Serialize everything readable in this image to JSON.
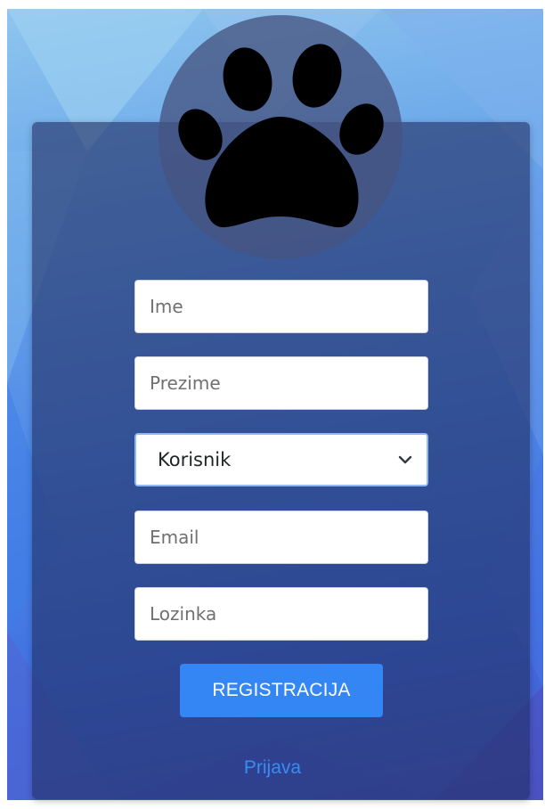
{
  "form": {
    "first_name_placeholder": "Ime",
    "last_name_placeholder": "Prezime",
    "role_select": {
      "selected": "Korisnik"
    },
    "email_placeholder": "Email",
    "password_placeholder": "Lozinka",
    "register_label": "REGISTRACIJA",
    "login_link_label": "Prijava"
  },
  "logo": {
    "icon": "paw-icon"
  },
  "colors": {
    "primary_button": "#3486f4",
    "link": "#3a8bf2",
    "card": "#222e64",
    "paw": "#000000"
  }
}
